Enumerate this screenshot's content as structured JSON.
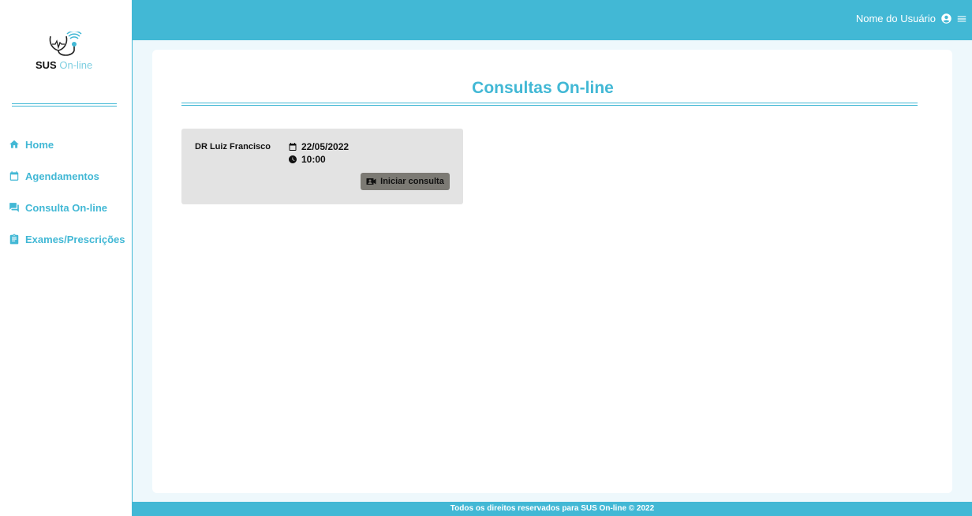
{
  "brand": {
    "name_bold": "SUS",
    "name_light": "On-line"
  },
  "header": {
    "user_name": "Nome do Usuário",
    "user_icon": "account-circle-icon",
    "menu_icon": "hamburger-menu-icon"
  },
  "sidebar": {
    "items": [
      {
        "label": "Home",
        "icon": "home-icon"
      },
      {
        "label": "Agendamentos",
        "icon": "calendar-icon"
      },
      {
        "label": "Consulta On-line",
        "icon": "chat-icon"
      },
      {
        "label": "Exames/Prescrições",
        "icon": "clipboard-icon"
      }
    ]
  },
  "main": {
    "title": "Consultas On-line",
    "consultations": [
      {
        "doctor": "DR Luiz Francisco",
        "date": "22/05/2022",
        "time": "10:00",
        "button_label": "Iniciar consulta"
      }
    ]
  },
  "footer": {
    "text": "Todos os direitos reservados para SUS On-line © 2022"
  },
  "colors": {
    "accent": "#42b8d5",
    "background": "#eef8fc",
    "card": "#e3e3e3",
    "button": "#7c7a74"
  }
}
